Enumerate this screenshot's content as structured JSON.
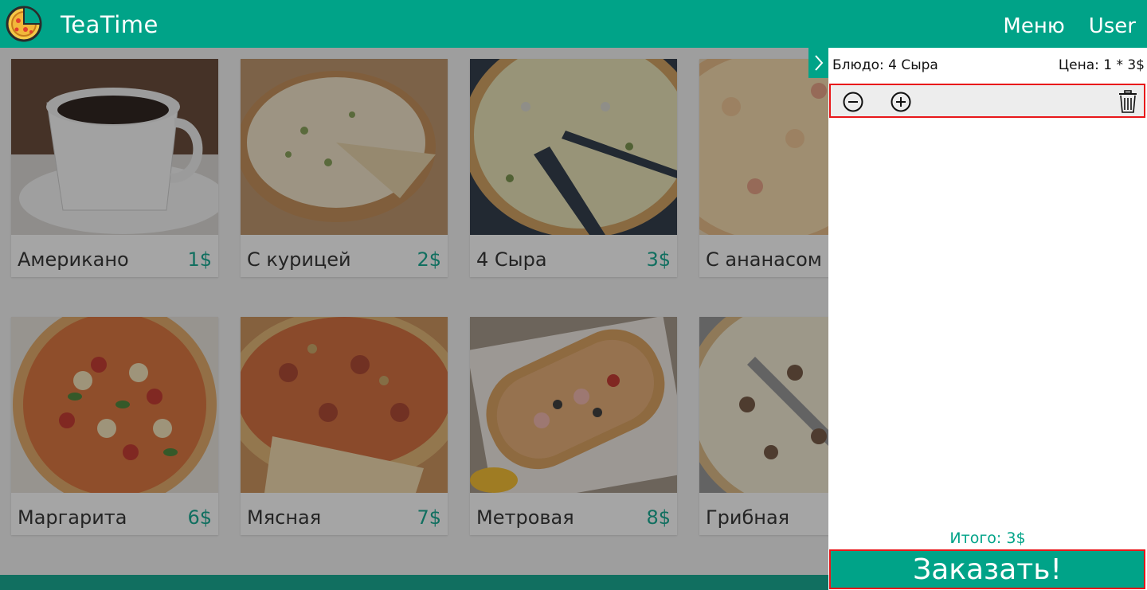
{
  "app": {
    "brand": "TeaTime"
  },
  "nav": {
    "menu": "Меню",
    "user": "User"
  },
  "products": [
    {
      "name": "Американо",
      "price": "1$"
    },
    {
      "name": "С курицей",
      "price": "2$"
    },
    {
      "name": "4 Сыра",
      "price": "3$"
    },
    {
      "name": "С ананасом",
      "price": ""
    },
    {
      "name": "Маргарита",
      "price": "6$"
    },
    {
      "name": "Мясная",
      "price": "7$"
    },
    {
      "name": "Метровая",
      "price": "8$"
    },
    {
      "name": "Грибная",
      "price": ""
    }
  ],
  "cart": {
    "item_label": "Блюдо: 4 Сыра",
    "price_label": "Цена: 1 * 3$",
    "total": "Итого: 3$",
    "order_button": "Заказать!"
  },
  "icons": {
    "collapse": "chevron-right-icon",
    "minus": "minus-circle-icon",
    "plus": "plus-circle-icon",
    "delete": "trash-icon"
  },
  "colors": {
    "accent": "#00a388",
    "highlight": "#e8171a"
  }
}
